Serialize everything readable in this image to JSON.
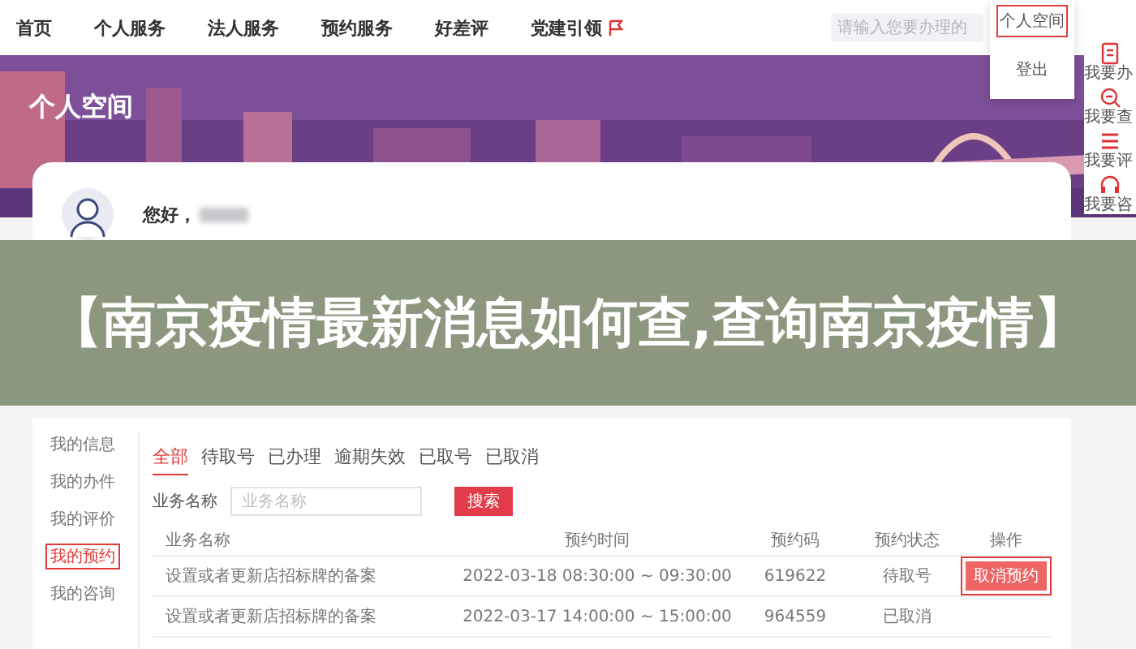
{
  "nav": {
    "items": [
      {
        "label": "首页"
      },
      {
        "label": "个人服务"
      },
      {
        "label": "法人服务"
      },
      {
        "label": "预约服务"
      },
      {
        "label": "好差评"
      },
      {
        "label": "党建引领"
      }
    ],
    "search": {
      "placeholder": "请输入您要办理的"
    }
  },
  "user_menu": [
    {
      "label": "个人空间",
      "highlighted": true
    },
    {
      "label": "登出",
      "highlighted": false
    }
  ],
  "quick_bar": [
    {
      "label": "我要办"
    },
    {
      "label": "我要查"
    },
    {
      "label": "我要评"
    },
    {
      "label": "我要咨"
    }
  ],
  "hero": {
    "title": "个人空间"
  },
  "profile": {
    "greeting": "您好，"
  },
  "banner": {
    "text": "【南京疫情最新消息如何查,查询南京疫情】"
  },
  "menu": [
    {
      "label": "我的信息",
      "selected": false,
      "highlighted": false
    },
    {
      "label": "我的办件",
      "selected": false,
      "highlighted": false
    },
    {
      "label": "我的评价",
      "selected": false,
      "highlighted": false
    },
    {
      "label": "我的预约",
      "selected": true,
      "highlighted": true
    },
    {
      "label": "我的咨询",
      "selected": false,
      "highlighted": false
    }
  ],
  "tabs": [
    {
      "label": "全部",
      "selected": true
    },
    {
      "label": "待取号",
      "selected": false
    },
    {
      "label": "已办理",
      "selected": false
    },
    {
      "label": "逾期失效",
      "selected": false
    },
    {
      "label": "已取号",
      "selected": false
    },
    {
      "label": "已取消",
      "selected": false
    }
  ],
  "filter": {
    "label": "业务名称",
    "placeholder": "业务名称",
    "button": "搜索"
  },
  "table": {
    "columns": [
      "业务名称",
      "预约时间",
      "预约码",
      "预约状态",
      "操作"
    ],
    "rows": [
      {
        "cells": [
          "设置或者更新店招标牌的备案",
          "2022-03-18 08:30:00 ~ 09:30:00",
          "619622",
          "待取号"
        ],
        "action": {
          "label": "取消预约",
          "highlighted": true
        }
      },
      {
        "cells": [
          "设置或者更新店招标牌的备案",
          "2022-03-17 14:00:00 ~ 15:00:00",
          "964559",
          "已取消"
        ]
      }
    ]
  }
}
